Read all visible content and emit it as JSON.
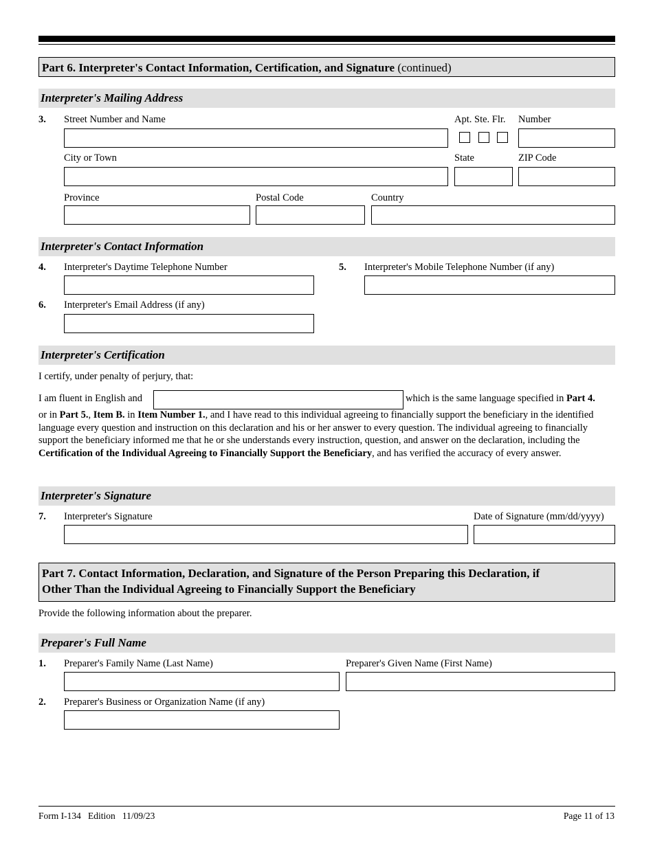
{
  "part6": {
    "title": "Part 6.  Interpreter's Contact Information, Certification, and Signature",
    "continued": " (continued)",
    "mailing": {
      "header": "Interpreter's Mailing Address",
      "item_num": "3.",
      "street_label": "Street Number and Name",
      "apt_label": "Apt. Ste. Flr.",
      "number_label": "Number",
      "city_label": "City or Town",
      "state_label": "State",
      "zip_label": "ZIP Code",
      "province_label": "Province",
      "postal_label": "Postal Code",
      "country_label": "Country",
      "values": {
        "street": "",
        "number": "",
        "city": "",
        "state": "",
        "zip": "",
        "province": "",
        "postal": "",
        "country": ""
      }
    },
    "contact": {
      "header": "Interpreter's Contact Information",
      "item4_num": "4.",
      "item4_label": "Interpreter's Daytime Telephone Number",
      "item5_num": "5.",
      "item5_label": "Interpreter's Mobile Telephone Number (if any)",
      "item6_num": "6.",
      "item6_label": "Interpreter's Email Address (if any)"
    },
    "certification": {
      "header": "Interpreter's Certification",
      "intro": "I certify, under penalty of perjury, that:",
      "fluent_prefix": "I am fluent in English and",
      "fluent_suffix": "which is the same language specified in ",
      "part4": "Part 4.",
      "body_or_in": "or in ",
      "part5": "Part 5.",
      "comma": ", ",
      "itemB": "Item B.",
      "in": " in ",
      "item_number": "Item Number 1.",
      "body_main": ", and I have read to this individual agreeing to financially support the beneficiary in the identified language every question and instruction on this declaration and his or her answer to every question.  The individual agreeing to financially support the beneficiary informed me that he or she understands every instruction, question, and answer on the declaration, including the ",
      "cert_bold": "Certification of the Individual Agreeing to Financially Support the Beneficiary",
      "body_end": ", and has verified the accuracy of every answer."
    },
    "signature": {
      "header": "Interpreter's Signature",
      "item_num": "7.",
      "sig_label": "Interpreter's Signature",
      "date_label": "Date of Signature (mm/dd/yyyy)"
    }
  },
  "part7": {
    "title_line1": "Part 7.  Contact Information, Declaration, and Signature of the Person Preparing this Declaration, if",
    "title_line2": "Other Than the Individual Agreeing to Financially Support the Beneficiary",
    "intro": "Provide the following information about the preparer.",
    "fullname": {
      "header": "Preparer's Full Name",
      "item1_num": "1.",
      "family_label": "Preparer's Family Name (Last Name)",
      "given_label": "Preparer's Given Name (First Name)",
      "item2_num": "2.",
      "business_label": "Preparer's Business or Organization Name (if any)"
    }
  },
  "footer": {
    "form": "Form I-134   Edition   11/09/23",
    "page": "Page 11 of 13"
  }
}
